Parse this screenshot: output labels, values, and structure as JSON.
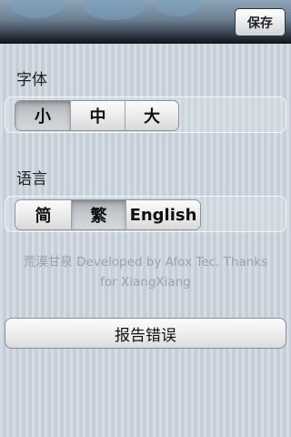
{
  "nav": {
    "save_label": "保存"
  },
  "font_section": {
    "label": "字体",
    "options": [
      "小",
      "中",
      "大"
    ],
    "selected": "小"
  },
  "language_section": {
    "label": "语言",
    "options": [
      "简",
      "繁",
      "English"
    ],
    "selected": "繁"
  },
  "credit": {
    "line1": "荒漠甘泉 Developed by Afox Tec. Thanks",
    "line2": "for XiangXiang"
  },
  "report_button": {
    "label": "报告错误"
  }
}
